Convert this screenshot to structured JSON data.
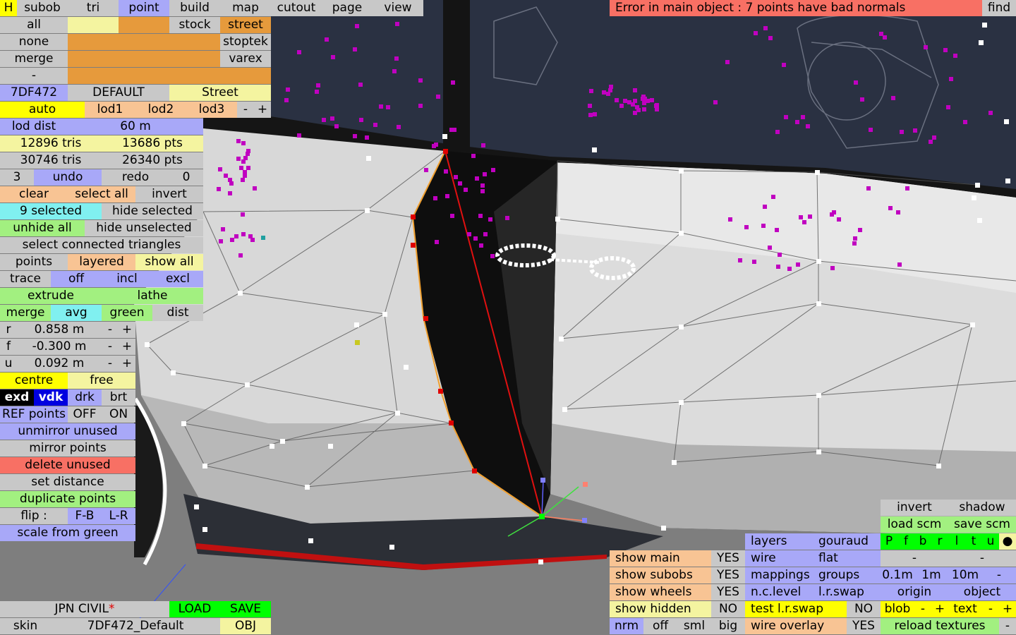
{
  "top_menu": {
    "h": "H",
    "subob": "subob",
    "tri": "tri",
    "point": "point",
    "build": "build",
    "map": "map",
    "cutout": "cutout",
    "page": "page",
    "view": "view"
  },
  "error_message": "Error in main object : 7 points have bad normals",
  "find": "find",
  "select": {
    "all": "all",
    "none": "none",
    "merge": "merge",
    "dash": "-"
  },
  "presets": {
    "stock": "stock",
    "street": "street",
    "stoptek": "stoptek",
    "varex": "varex"
  },
  "car": {
    "code": "7DF472",
    "skin_set": "DEFAULT",
    "preset": "Street"
  },
  "lod": {
    "auto": "auto",
    "lod1": "lod1",
    "lod2": "lod2",
    "lod3": "lod3",
    "minus": "-",
    "plus": "+",
    "dist_label": "lod dist",
    "dist_value": "60 m"
  },
  "stats": {
    "tris1": "12896 tris",
    "pts1": "13686 pts",
    "tris2": "30746 tris",
    "pts2": "26340 pts"
  },
  "undo": {
    "count": "3",
    "undo": "undo",
    "redo": "redo",
    "redo_count": "0"
  },
  "selection": {
    "clear": "clear",
    "select_all": "select all",
    "invert": "invert",
    "selected": "9 selected",
    "hide_selected": "hide selected",
    "unhide_all": "unhide all",
    "hide_unselected": "hide unselected",
    "select_connected": "select connected triangles"
  },
  "points_row": {
    "points": "points",
    "layered": "layered",
    "show_all": "show all"
  },
  "trace_row": {
    "trace": "trace",
    "off": "off",
    "incl": "incl",
    "excl": "excl"
  },
  "extrude": "extrude",
  "lathe": "lathe",
  "merge_row": {
    "merge": "merge",
    "avg": "avg",
    "green": "green",
    "dist": "dist"
  },
  "coords": [
    {
      "axis": "r",
      "value": "0.858 m"
    },
    {
      "axis": "f",
      "value": "-0.300 m"
    },
    {
      "axis": "u",
      "value": "0.092 m"
    }
  ],
  "pm": {
    "minus": "-",
    "plus": "+"
  },
  "centre": "centre",
  "free": "free",
  "shade": {
    "exd": "exd",
    "vdk": "vdk",
    "drk": "drk",
    "brt": "brt"
  },
  "ref_points": {
    "label": "REF points",
    "off": "OFF",
    "on": "ON"
  },
  "actions": {
    "unmirror": "unmirror unused",
    "mirror": "mirror points",
    "delete_unused": "delete unused",
    "set_distance": "set distance",
    "duplicate": "duplicate points",
    "flip": "flip :",
    "fb": "F-B",
    "lr": "L-R",
    "scale": "scale from green"
  },
  "file": {
    "name": "JPN CIVIL",
    "star": "*",
    "load": "LOAD",
    "save": "SAVE",
    "skin": "skin",
    "skin_name": "7DF472_Default",
    "obj": "OBJ"
  },
  "display": {
    "show_main": "show main",
    "show_main_v": "YES",
    "show_subobs": "show subobs",
    "show_subobs_v": "YES",
    "show_wheels": "show wheels",
    "show_wheels_v": "YES",
    "show_hidden": "show hidden",
    "show_hidden_v": "NO",
    "nrm": "nrm",
    "off": "off",
    "sml": "sml",
    "big": "big"
  },
  "render": {
    "layers": "layers",
    "gouraud": "gouraud",
    "wire": "wire",
    "flat": "flat",
    "mappings": "mappings",
    "groups": "groups",
    "nclevel": "n.c.level",
    "lrswap": "l.r.swap",
    "test_lrswap": "test l.r.swap",
    "test_lrswap_v": "NO",
    "wire_overlay": "wire overlay",
    "wire_overlay_v": "YES"
  },
  "right_panel": {
    "invert": "invert",
    "shadow": "shadow",
    "load_scm": "load scm",
    "save_scm": "save scm",
    "letters": [
      "P",
      "f",
      "b",
      "r",
      "l",
      "t",
      "u",
      "●"
    ],
    "dash1": "-",
    "dash2": "-",
    "g01": "0.1m",
    "g1": "1m",
    "g10": "10m",
    "gdash": "-",
    "origin": "origin",
    "object": "object",
    "blob": "blob",
    "text": "text",
    "reload": "reload textures",
    "dash3": "-"
  },
  "colors": {
    "select_point": "#c000c0",
    "vertex": "#ffffff",
    "error_bg": "#f87064"
  }
}
